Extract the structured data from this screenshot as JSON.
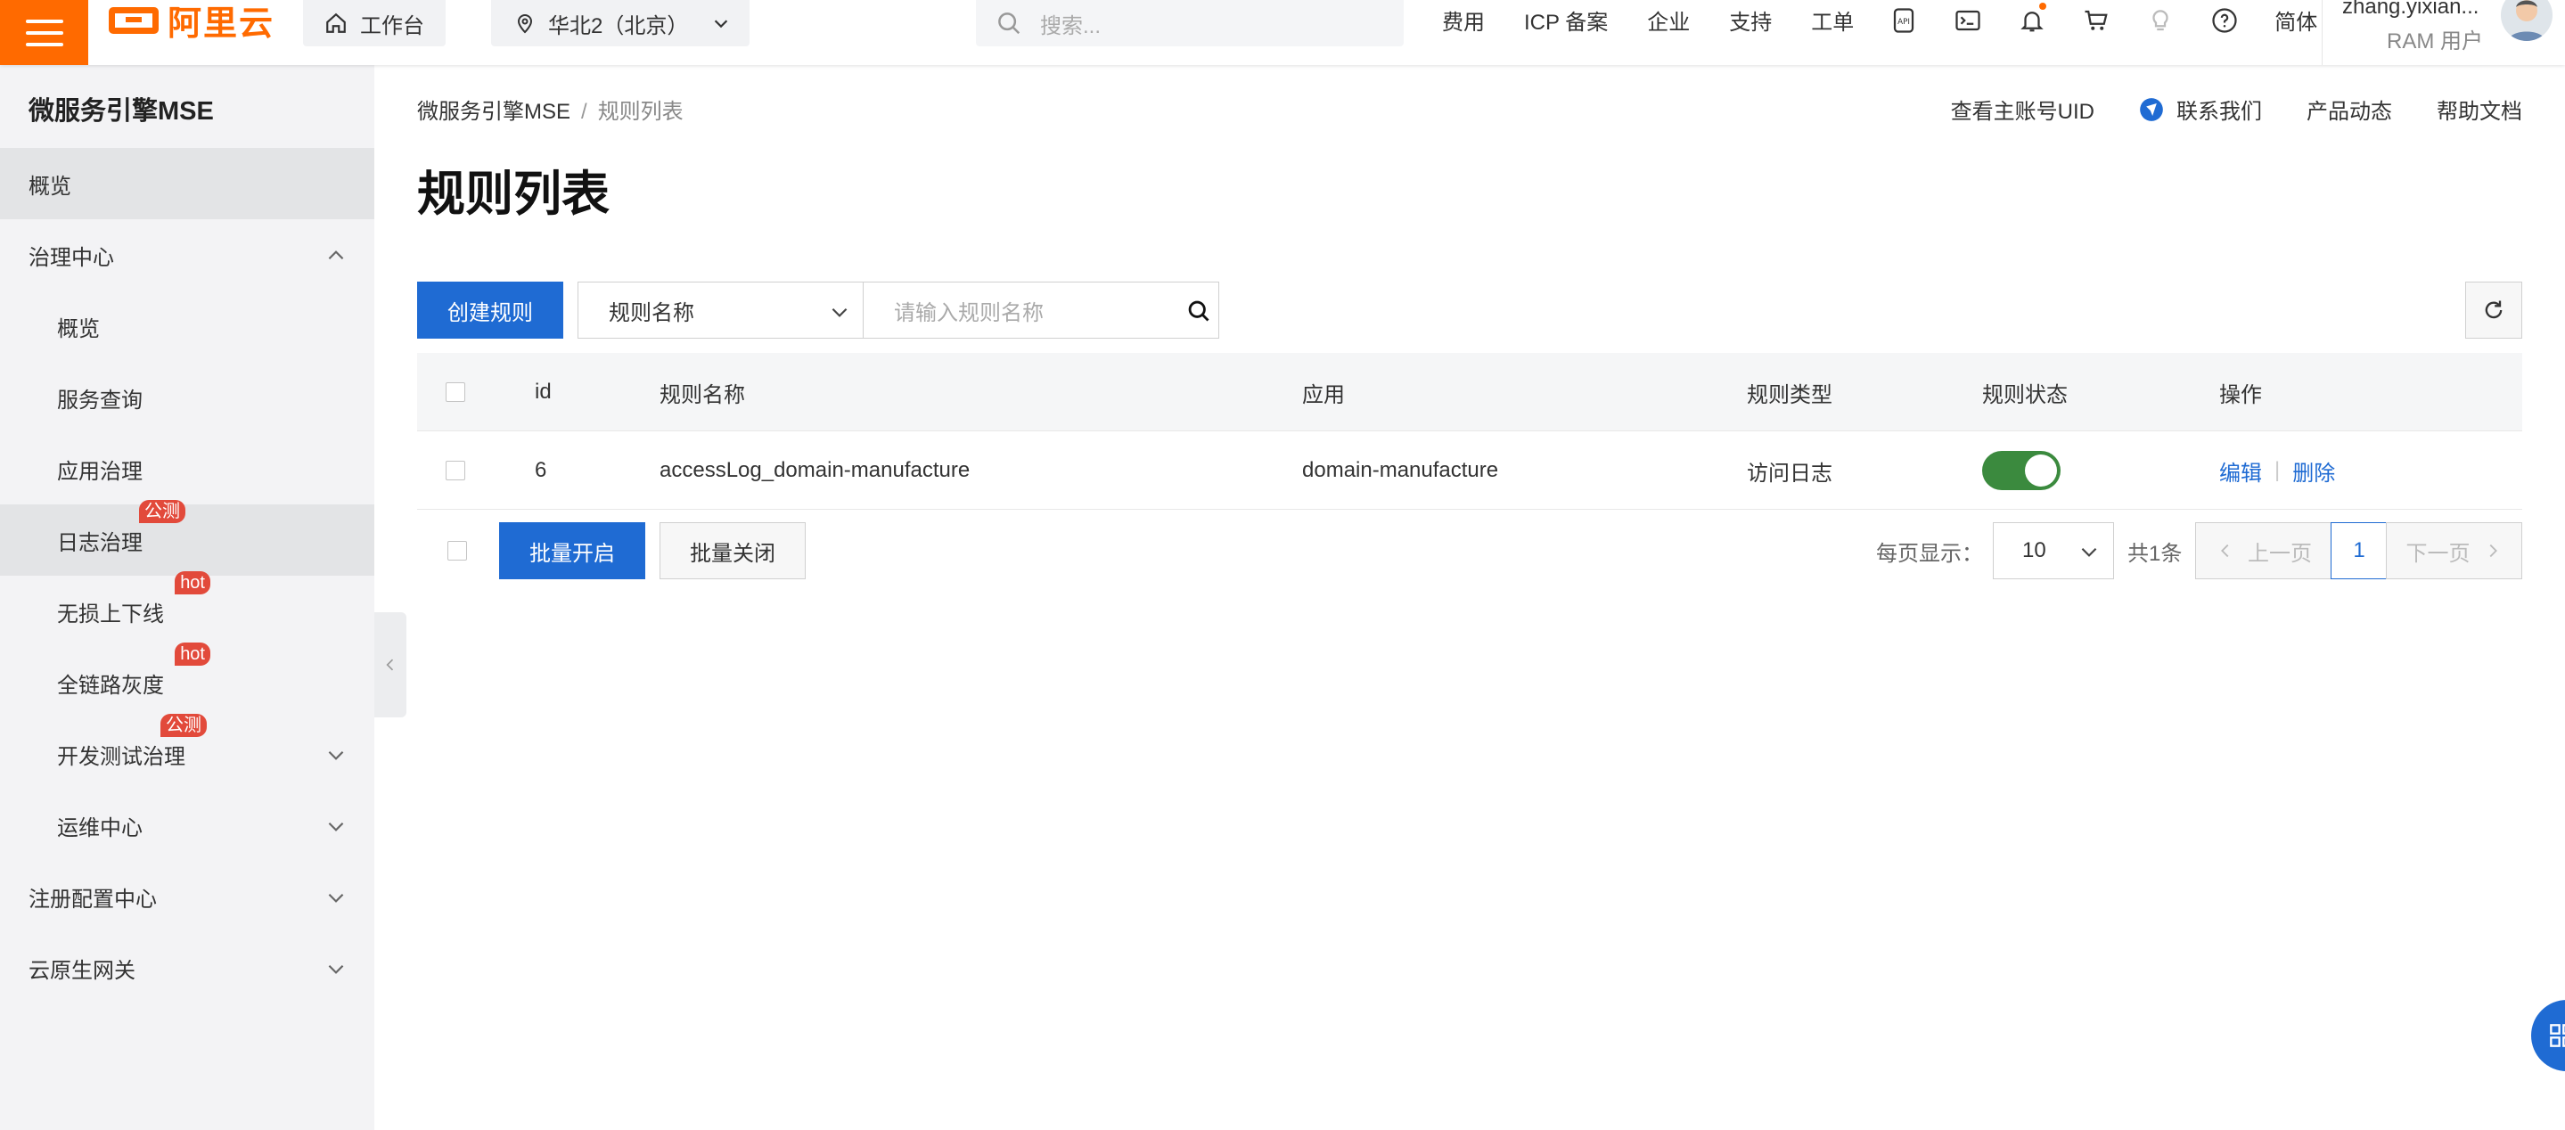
{
  "topbar": {
    "logo_text": "阿里云",
    "workbench": "工作台",
    "region": "华北2（北京）",
    "search_placeholder": "搜索...",
    "nav": [
      "费用",
      "ICP 备案",
      "企业",
      "支持",
      "工单"
    ],
    "lang": "简体",
    "user_name": "zhang.yixian...",
    "user_role": "RAM 用户"
  },
  "sidebar": {
    "title": "微服务引擎MSE",
    "items": [
      {
        "label": "概览"
      },
      {
        "label": "治理中心"
      },
      {
        "label": "概览"
      },
      {
        "label": "服务查询"
      },
      {
        "label": "应用治理"
      },
      {
        "label": "日志治理",
        "badge": "公测"
      },
      {
        "label": "无损上下线",
        "badge": "hot"
      },
      {
        "label": "全链路灰度",
        "badge": "hot"
      },
      {
        "label": "开发测试治理",
        "badge": "公测"
      },
      {
        "label": "运维中心"
      },
      {
        "label": "注册配置中心"
      },
      {
        "label": "云原生网关"
      }
    ]
  },
  "breadcrumb": {
    "root": "微服务引擎MSE",
    "sep": "/",
    "current": "规则列表"
  },
  "header_links": {
    "uid": "查看主账号UID",
    "contact": "联系我们",
    "news": "产品动态",
    "help": "帮助文档"
  },
  "page_title": "规则列表",
  "toolbar": {
    "create": "创建规则",
    "filter_select": "规则名称",
    "search_placeholder": "请输入规则名称"
  },
  "table": {
    "columns": [
      "id",
      "规则名称",
      "应用",
      "规则类型",
      "规则状态",
      "操作"
    ],
    "rows": [
      {
        "id": "6",
        "name": "accessLog_domain-manufacture",
        "app": "domain-manufacture",
        "type": "访问日志",
        "enabled": true,
        "edit": "编辑",
        "delete": "删除"
      }
    ]
  },
  "footer": {
    "bulk_on": "批量开启",
    "bulk_off": "批量关闭",
    "page_size_label": "每页显示：",
    "page_size": "10",
    "total": "共1条",
    "prev": "上一页",
    "page": "1",
    "next": "下一页"
  },
  "colors": {
    "brand": "#ff6a00",
    "primary": "#1f6bd3",
    "switch_on": "#3b8a3e",
    "badge": "#e24a3b"
  }
}
